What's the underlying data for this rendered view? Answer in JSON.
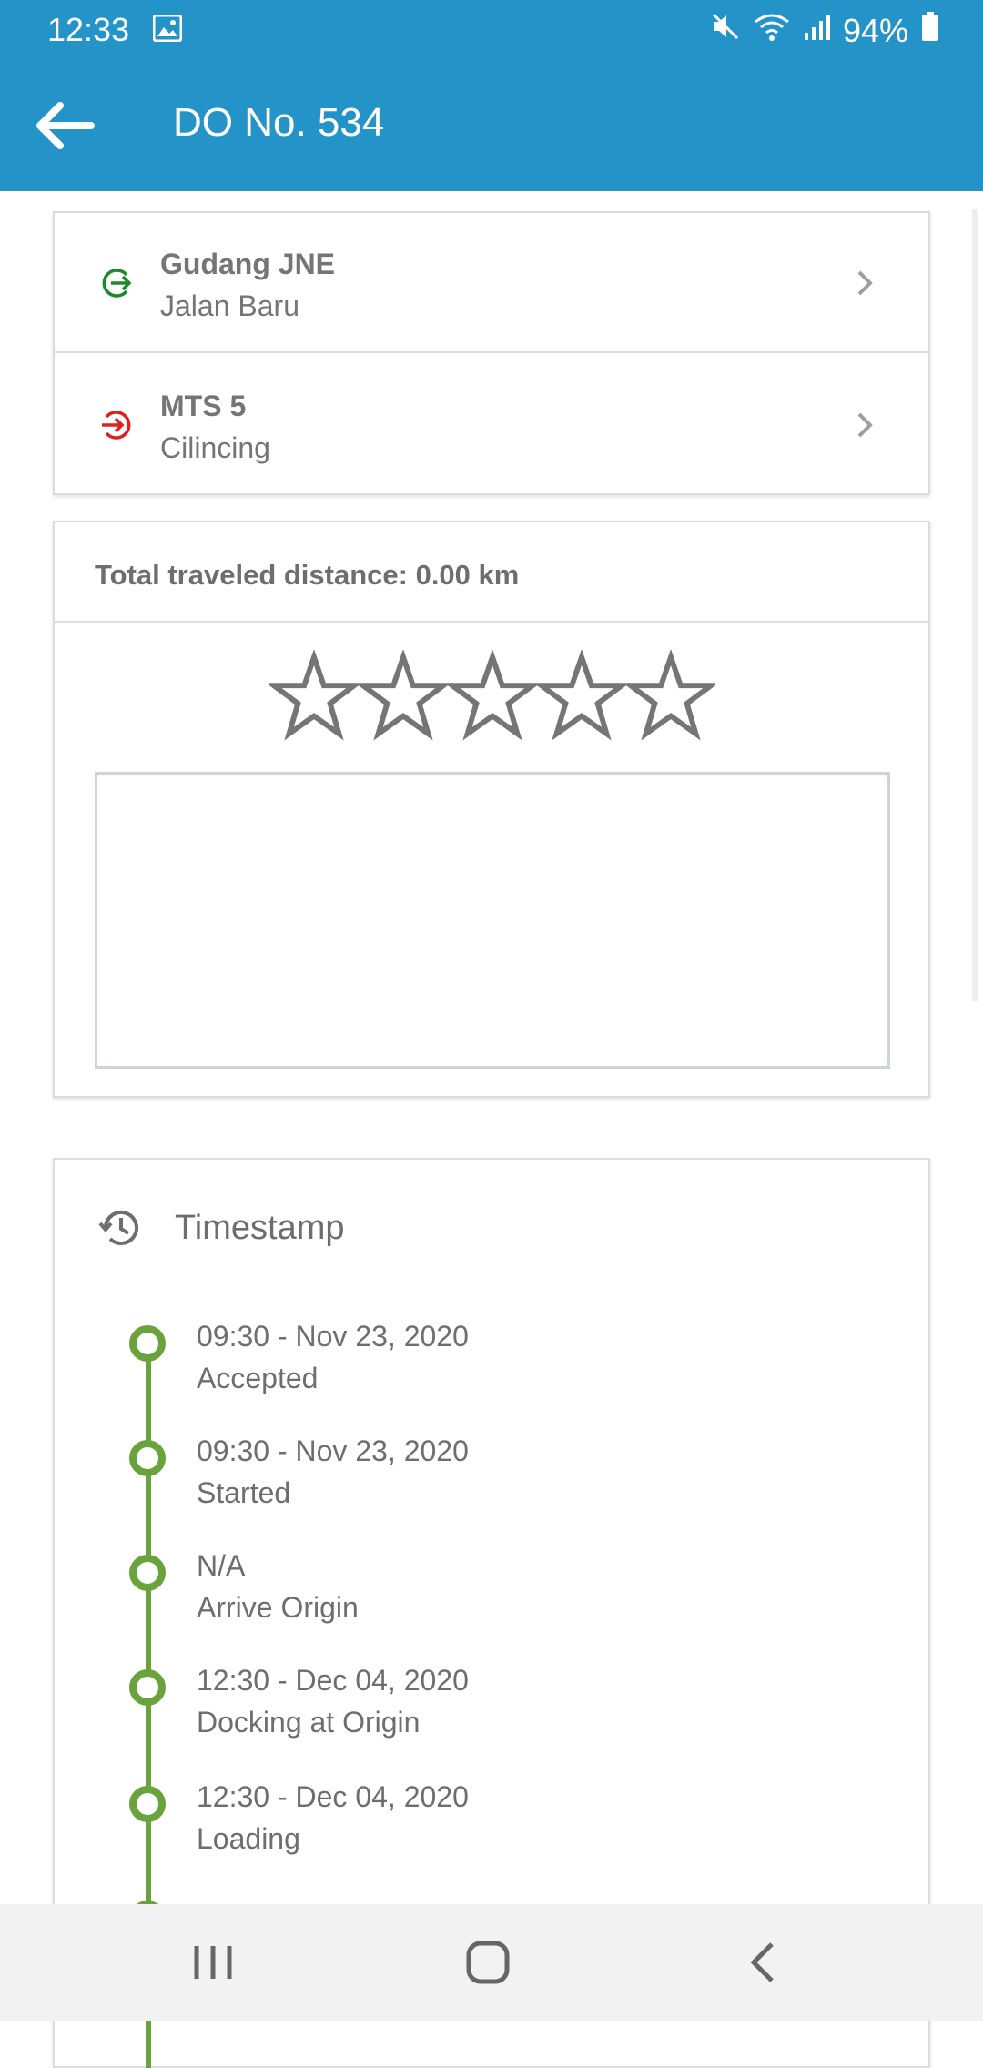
{
  "status_bar": {
    "time": "12:33",
    "battery": "94%"
  },
  "app_bar": {
    "title": "DO No. 534"
  },
  "locations": [
    {
      "name": "Gudang JNE",
      "sub": "Jalan Baru",
      "color": "#1b8a2b",
      "icon": "origin-icon"
    },
    {
      "name": "MTS 5",
      "sub": "Cilincing",
      "color": "#e02020",
      "icon": "destination-icon"
    }
  ],
  "rating": {
    "distance_text": "Total traveled distance: 0.00 km",
    "stars_total": 5,
    "stars_selected": 0,
    "comment_value": ""
  },
  "timestamp": {
    "title": "Timestamp",
    "accent": "#6aa33c",
    "items": [
      {
        "time": "09:30 - Nov 23, 2020",
        "label": "Accepted"
      },
      {
        "time": "09:30 - Nov 23, 2020",
        "label": "Started"
      },
      {
        "time": "N/A",
        "label": "Arrive Origin"
      },
      {
        "time": "12:30 - Dec 04, 2020",
        "label": "Docking at Origin"
      },
      {
        "time": "12:30 - Dec 04, 2020",
        "label": "Loading"
      }
    ]
  },
  "colors": {
    "primary": "#2493c7"
  }
}
